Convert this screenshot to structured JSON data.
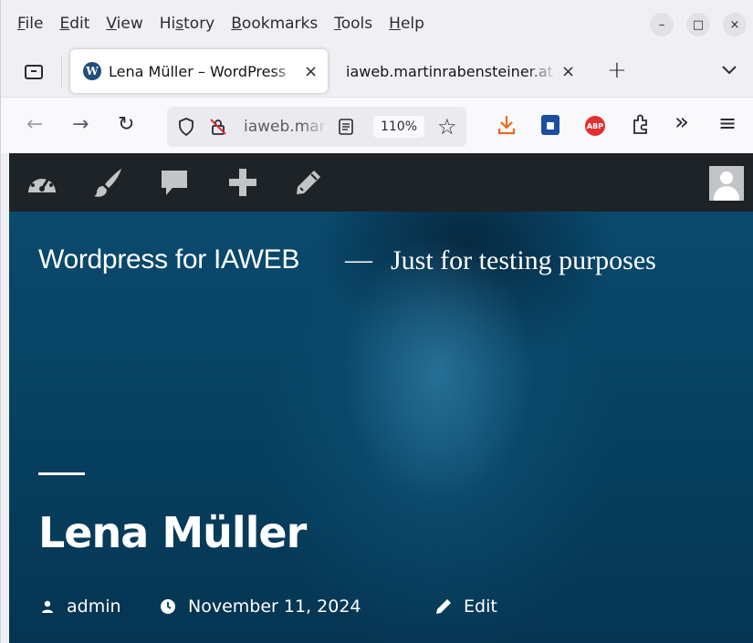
{
  "menubar": {
    "items": [
      "File",
      "Edit",
      "View",
      "History",
      "Bookmarks",
      "Tools",
      "Help"
    ],
    "underlined_letters": [
      "F",
      "E",
      "V",
      "s",
      "B",
      "T",
      "H"
    ]
  },
  "window_controls": {
    "minimize": "–",
    "maximize": "□",
    "close": "×"
  },
  "tabs": [
    {
      "title": "Lena Müller – WordPress",
      "active": true,
      "close": "×"
    },
    {
      "title": "iaweb.martinrabensteiner.at",
      "active": false,
      "close": "×"
    }
  ],
  "tabstrip": {
    "new_tab": "+",
    "list_all": "⌄"
  },
  "navbar": {
    "back": "←",
    "forward": "→",
    "reload": "↻",
    "url": "iaweb.martinrabensteiner.at",
    "zoom": "110%",
    "bookmark": "☆",
    "abp_label": "ABP",
    "overflow": "»",
    "menu": "≡"
  },
  "adminbar": {
    "icons": [
      "dashboard-icon",
      "customize-brush-icon",
      "comments-icon",
      "new-content-plus-icon",
      "edit-pencil-icon"
    ],
    "bg": "#1d2327"
  },
  "header": {
    "site_title": "Wordpress for IAWEB",
    "separator": "—",
    "description": "Just for testing purposes"
  },
  "post": {
    "title": "Lena Müller",
    "author": "admin",
    "date": "November 11, 2024",
    "edit_label": "Edit"
  },
  "colors": {
    "hero_tint": "#06405f",
    "abp_red": "#e0312f",
    "download_orange": "#e66a21"
  }
}
